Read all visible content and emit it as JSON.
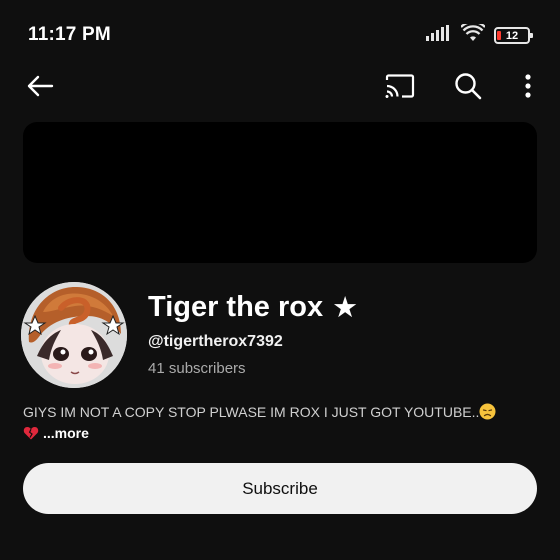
{
  "status_bar": {
    "time": "11:17 PM",
    "battery_level": "12",
    "icons": [
      "signal-icon",
      "wifi-icon",
      "battery-icon"
    ]
  },
  "app_bar": {
    "icons": [
      "back-arrow-icon",
      "cast-icon",
      "search-icon",
      "more-vert-icon"
    ]
  },
  "channel": {
    "name": "Tiger the rox",
    "name_badge": "★",
    "handle": "@tigertherox7392",
    "subscribers": "41 subscribers",
    "description": "GIYS IM NOT A COPY STOP PLWASE IM ROX I JUST GOT YOUTUBE..",
    "more_label": "...more",
    "subscribe_label": "Subscribe"
  },
  "colors": {
    "background": "#0f0f0f",
    "banner": "#000000",
    "button_bg": "#f1f1f1",
    "secondary_text": "#aaaaaa",
    "battery_low": "#ff3b30"
  }
}
